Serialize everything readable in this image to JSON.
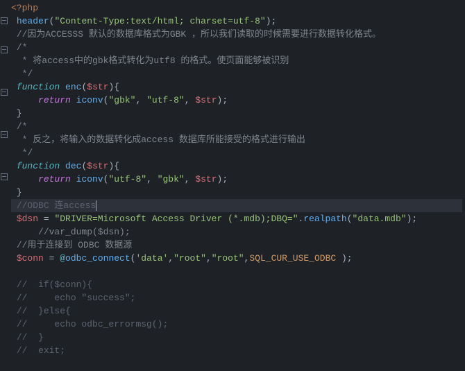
{
  "lines": [
    {
      "tokens": [
        {
          "cls": "php-tag",
          "text": "<?php"
        }
      ]
    },
    {
      "fold": true,
      "tokens": [
        {
          "cls": "punctuation",
          "text": " "
        },
        {
          "cls": "builtin-call",
          "text": "header"
        },
        {
          "cls": "punctuation",
          "text": "("
        },
        {
          "cls": "string",
          "text": "\"Content-Type:text/html; charset=utf-8\""
        },
        {
          "cls": "punctuation",
          "text": ");"
        }
      ]
    },
    {
      "tokens": [
        {
          "cls": "punctuation",
          "text": " "
        },
        {
          "cls": "comment",
          "text": "//因为ACCESSS 默认的数据库格式为GBK ，所以我们读取的时候需要进行数据转化格式。"
        }
      ]
    },
    {
      "fold": true,
      "tokens": [
        {
          "cls": "punctuation",
          "text": " "
        },
        {
          "cls": "comment",
          "text": "/*"
        }
      ]
    },
    {
      "tokens": [
        {
          "cls": "comment",
          "text": "  * 将access中的gbk格式转化为utf8 的格式。使页面能够被识别"
        }
      ]
    },
    {
      "tokens": [
        {
          "cls": "comment",
          "text": "  */"
        }
      ]
    },
    {
      "fold": true,
      "tokens": [
        {
          "cls": "punctuation",
          "text": " "
        },
        {
          "cls": "keyword-italic",
          "text": "function"
        },
        {
          "cls": "punctuation",
          "text": " "
        },
        {
          "cls": "function-name",
          "text": "enc"
        },
        {
          "cls": "punctuation",
          "text": "("
        },
        {
          "cls": "variable",
          "text": "$str"
        },
        {
          "cls": "punctuation",
          "text": "){"
        }
      ]
    },
    {
      "tokens": [
        {
          "cls": "punctuation",
          "text": "     "
        },
        {
          "cls": "keyword",
          "text": "return"
        },
        {
          "cls": "punctuation",
          "text": " "
        },
        {
          "cls": "builtin-call",
          "text": "iconv"
        },
        {
          "cls": "punctuation",
          "text": "("
        },
        {
          "cls": "string",
          "text": "\"gbk\""
        },
        {
          "cls": "punctuation",
          "text": ", "
        },
        {
          "cls": "string",
          "text": "\"utf-8\""
        },
        {
          "cls": "punctuation",
          "text": ", "
        },
        {
          "cls": "variable",
          "text": "$str"
        },
        {
          "cls": "punctuation",
          "text": ");"
        }
      ]
    },
    {
      "tokens": [
        {
          "cls": "punctuation",
          "text": " }"
        }
      ]
    },
    {
      "fold": true,
      "tokens": [
        {
          "cls": "punctuation",
          "text": " "
        },
        {
          "cls": "comment",
          "text": "/*"
        }
      ]
    },
    {
      "tokens": [
        {
          "cls": "comment",
          "text": "  * 反之，将输入的数据转化成access 数据库所能接受的格式进行输出"
        }
      ]
    },
    {
      "tokens": [
        {
          "cls": "comment",
          "text": "  */"
        }
      ]
    },
    {
      "fold": true,
      "tokens": [
        {
          "cls": "punctuation",
          "text": " "
        },
        {
          "cls": "keyword-italic",
          "text": "function"
        },
        {
          "cls": "punctuation",
          "text": " "
        },
        {
          "cls": "function-name",
          "text": "dec"
        },
        {
          "cls": "punctuation",
          "text": "("
        },
        {
          "cls": "variable",
          "text": "$str"
        },
        {
          "cls": "punctuation",
          "text": "){"
        }
      ]
    },
    {
      "tokens": [
        {
          "cls": "punctuation",
          "text": "     "
        },
        {
          "cls": "keyword",
          "text": "return"
        },
        {
          "cls": "punctuation",
          "text": " "
        },
        {
          "cls": "builtin-call",
          "text": "iconv"
        },
        {
          "cls": "punctuation",
          "text": "("
        },
        {
          "cls": "string",
          "text": "\"utf-8\""
        },
        {
          "cls": "punctuation",
          "text": ", "
        },
        {
          "cls": "string",
          "text": "\"gbk\""
        },
        {
          "cls": "punctuation",
          "text": ", "
        },
        {
          "cls": "variable",
          "text": "$str"
        },
        {
          "cls": "punctuation",
          "text": ");"
        }
      ]
    },
    {
      "tokens": [
        {
          "cls": "punctuation",
          "text": " }"
        }
      ]
    },
    {
      "highlighted": true,
      "tokens": [
        {
          "cls": "punctuation",
          "text": " "
        },
        {
          "cls": "comment-gray",
          "text": "//ODBC 连access"
        }
      ],
      "cursor": true
    },
    {
      "tokens": [
        {
          "cls": "punctuation",
          "text": " "
        },
        {
          "cls": "variable",
          "text": "$dsn"
        },
        {
          "cls": "punctuation",
          "text": " = "
        },
        {
          "cls": "string",
          "text": "\"DRIVER=Microsoft Access Driver (*.mdb);DBQ=\""
        },
        {
          "cls": "punctuation",
          "text": "."
        },
        {
          "cls": "builtin-call",
          "text": "realpath"
        },
        {
          "cls": "punctuation",
          "text": "("
        },
        {
          "cls": "string",
          "text": "\"data.mdb\""
        },
        {
          "cls": "punctuation",
          "text": ");"
        }
      ]
    },
    {
      "tokens": [
        {
          "cls": "punctuation",
          "text": "     "
        },
        {
          "cls": "comment",
          "text": "//var_dump($dsn);"
        }
      ]
    },
    {
      "tokens": [
        {
          "cls": "punctuation",
          "text": " "
        },
        {
          "cls": "comment",
          "text": "//用于连接到 ODBC 数据源"
        }
      ]
    },
    {
      "tokens": [
        {
          "cls": "punctuation",
          "text": " "
        },
        {
          "cls": "variable",
          "text": "$conn"
        },
        {
          "cls": "punctuation",
          "text": " = "
        },
        {
          "cls": "at-op",
          "text": "@"
        },
        {
          "cls": "builtin-call",
          "text": "odbc_connect"
        },
        {
          "cls": "punctuation",
          "text": "("
        },
        {
          "cls": "string",
          "text": "'data'"
        },
        {
          "cls": "punctuation",
          "text": ","
        },
        {
          "cls": "string",
          "text": "\"root\""
        },
        {
          "cls": "punctuation",
          "text": ","
        },
        {
          "cls": "string",
          "text": "\"root\""
        },
        {
          "cls": "punctuation",
          "text": ","
        },
        {
          "cls": "constant",
          "text": "SQL_CUR_USE_ODBC"
        },
        {
          "cls": "punctuation",
          "text": " );"
        }
      ]
    },
    {
      "tokens": []
    },
    {
      "tokens": [
        {
          "cls": "punctuation",
          "text": " "
        },
        {
          "cls": "comment-gray",
          "text": "//  if($conn){"
        }
      ]
    },
    {
      "tokens": [
        {
          "cls": "punctuation",
          "text": " "
        },
        {
          "cls": "comment-gray",
          "text": "//     echo \"success\";"
        }
      ]
    },
    {
      "tokens": [
        {
          "cls": "punctuation",
          "text": " "
        },
        {
          "cls": "comment-gray",
          "text": "//  }else{"
        }
      ]
    },
    {
      "tokens": [
        {
          "cls": "punctuation",
          "text": " "
        },
        {
          "cls": "comment-gray",
          "text": "//     echo odbc_errormsg();"
        }
      ]
    },
    {
      "tokens": [
        {
          "cls": "punctuation",
          "text": " "
        },
        {
          "cls": "comment-gray",
          "text": "//  }"
        }
      ]
    },
    {
      "tokens": [
        {
          "cls": "punctuation",
          "text": " "
        },
        {
          "cls": "comment-gray",
          "text": "//  exit;"
        }
      ]
    }
  ]
}
